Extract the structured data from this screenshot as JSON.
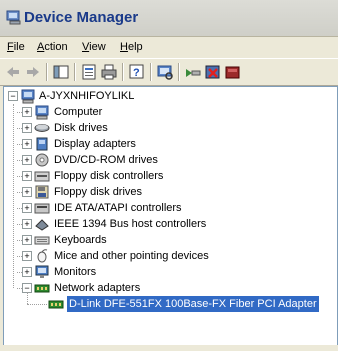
{
  "window": {
    "title": "Device Manager"
  },
  "menu": [
    {
      "key": "F",
      "rest": "ile"
    },
    {
      "key": "A",
      "rest": "ction"
    },
    {
      "key": "V",
      "rest": "iew"
    },
    {
      "key": "H",
      "rest": "elp"
    }
  ],
  "tree": {
    "root": "A-JYXNHIFOYLIKL",
    "categories": [
      {
        "label": "Computer",
        "icon": "computer-icon"
      },
      {
        "label": "Disk drives",
        "icon": "disk-drive-icon"
      },
      {
        "label": "Display adapters",
        "icon": "display-adapter-icon"
      },
      {
        "label": "DVD/CD-ROM drives",
        "icon": "cdrom-icon"
      },
      {
        "label": "Floppy disk controllers",
        "icon": "floppy-controller-icon"
      },
      {
        "label": "Floppy disk drives",
        "icon": "floppy-drive-icon"
      },
      {
        "label": "IDE ATA/ATAPI controllers",
        "icon": "ide-controller-icon"
      },
      {
        "label": "IEEE 1394 Bus host controllers",
        "icon": "firewire-icon"
      },
      {
        "label": "Keyboards",
        "icon": "keyboard-icon"
      },
      {
        "label": "Mice and other pointing devices",
        "icon": "mouse-icon"
      },
      {
        "label": "Monitors",
        "icon": "monitor-icon"
      },
      {
        "label": "Network adapters",
        "icon": "network-adapter-icon"
      }
    ],
    "network_child": "D-Link DFE-551FX 100Base-FX Fiber PCI Adapter"
  }
}
